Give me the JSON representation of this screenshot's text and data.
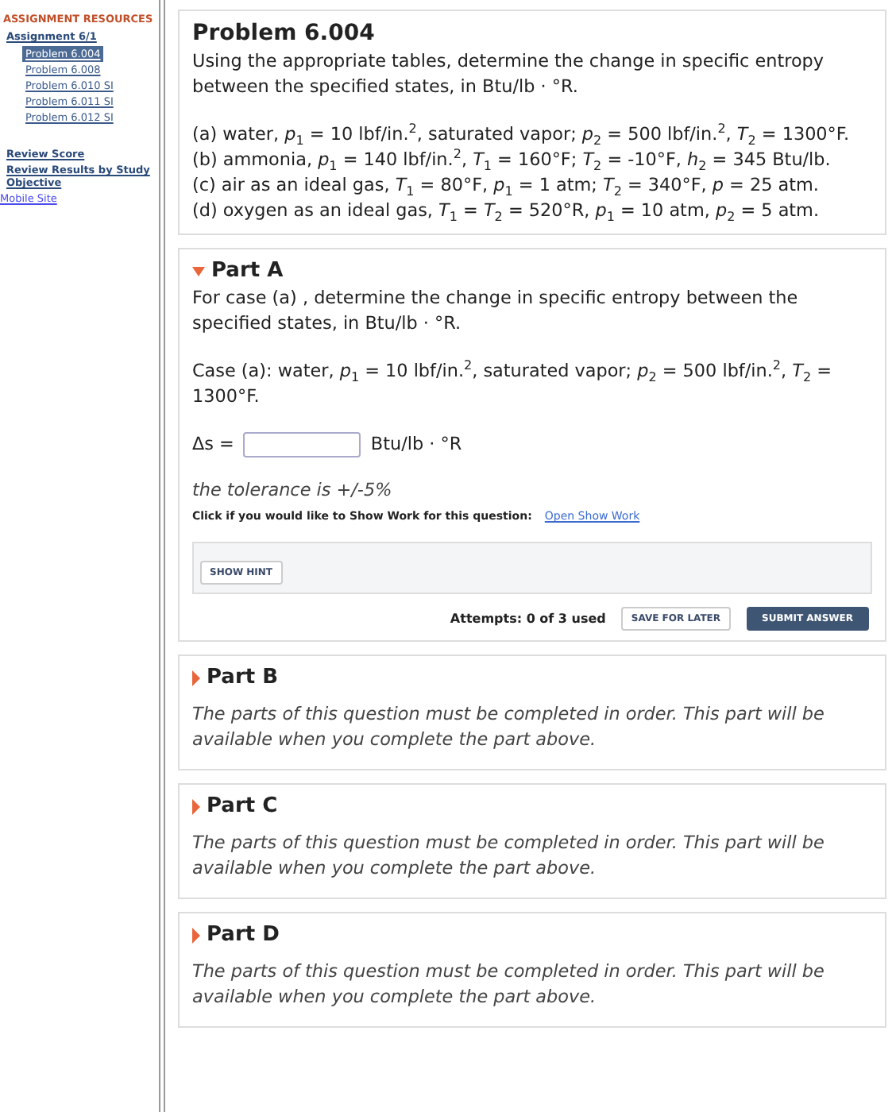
{
  "sidebar": {
    "heading": "ASSIGNMENT RESOURCES",
    "assignment": "Assignment 6/1",
    "problems": [
      {
        "label": "Problem 6.004",
        "selected": true
      },
      {
        "label": "Problem 6.008",
        "selected": false
      },
      {
        "label": "Problem 6.010 SI",
        "selected": false
      },
      {
        "label": "Problem 6.011 SI",
        "selected": false
      },
      {
        "label": "Problem 6.012 SI",
        "selected": false
      }
    ],
    "links": [
      "Review Score",
      "Review Results by Study Objective"
    ],
    "mobile_link": "Mobile Site"
  },
  "problem": {
    "title": "Problem 6.004",
    "intro": "Using the appropriate tables, determine the change in specific entropy between the specified states, in Btu/lb · °R.",
    "cases": [
      "(a) water, *p*$_{1}$ = 10 lbf/in.$^{2}$, saturated vapor; *p*$_{2}$ = 500 lbf/in.$^{2}$, *T*$_{2}$ = 1300°F.",
      "(b) ammonia, *p*$_{1}$ = 140 lbf/in.$^{2}$, *T*$_{1}$ = 160°F; *T*$_{2}$ = -10°F, *h*$_{2}$ = 345 Btu/lb.",
      "(c) air as an ideal gas, *T*$_{1}$ = 80°F, *p*$_{1}$ = 1 atm; *T*$_{2}$ = 340°F, *p* = 25 atm.",
      "(d) oxygen as an ideal gas, *T*$_{1}$ = *T*$_{2}$ = 520°R, *p*$_{1}$ = 10 atm, *p*$_{2}$ = 5 atm."
    ]
  },
  "parts": [
    {
      "title": "Part A",
      "expanded": true,
      "question": "For case (a) , determine the change in specific entropy between the specified states, in Btu/lb · °R.",
      "case": "Case (a): water, *p*$_{1}$ = 10 lbf/in.$^{2}$, saturated vapor; *p*$_{2}$ = 500 lbf/in.$^{2}$, *T*$_{2}$ = 1300°F.",
      "answer_label": "Δs =",
      "unit": "Btu/lb · °R",
      "tolerance": "the tolerance is +/-5%",
      "show_work_prompt": "Click if you would like to Show Work for this question:",
      "show_work_link": "Open Show Work",
      "hint_button": "SHOW HINT",
      "attempts": "Attempts: 0 of 3 used",
      "save_button": "SAVE FOR LATER",
      "submit_button": "SUBMIT ANSWER"
    },
    {
      "title": "Part B",
      "expanded": false,
      "locked_message": "The parts of this question must be completed in order. This part will be available when you complete the part above."
    },
    {
      "title": "Part C",
      "expanded": false,
      "locked_message": "The parts of this question must be completed in order. This part will be available when you complete the part above."
    },
    {
      "title": "Part D",
      "expanded": false,
      "locked_message": "The parts of this question must be completed in order. This part will be available when you complete the part above."
    }
  ]
}
